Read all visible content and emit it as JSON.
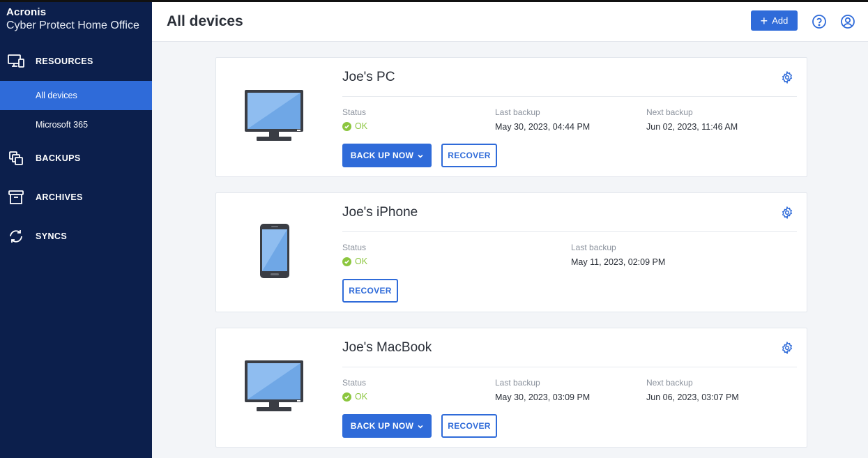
{
  "app": {
    "brand": "Acronis",
    "product": "Cyber Protect Home Office"
  },
  "sidebar": {
    "sections": [
      {
        "label": "RESOURCES",
        "icon": "devices-icon"
      },
      {
        "label": "BACKUPS",
        "icon": "backups-icon"
      },
      {
        "label": "ARCHIVES",
        "icon": "archive-box-icon"
      },
      {
        "label": "SYNCS",
        "icon": "sync-icon"
      }
    ],
    "resources_items": [
      {
        "label": "All devices",
        "active": true
      },
      {
        "label": "Microsoft 365",
        "active": false
      }
    ]
  },
  "header": {
    "title": "All devices",
    "add_label": "Add",
    "icons": [
      "help-icon",
      "account-icon"
    ]
  },
  "labels": {
    "status": "Status",
    "last_backup": "Last backup",
    "next_backup": "Next backup",
    "back_up_now": "BACK UP NOW",
    "recover": "RECOVER"
  },
  "devices": [
    {
      "name": "Joe's PC",
      "type": "desktop",
      "status": "OK",
      "last_backup": "May 30, 2023, 04:44 PM",
      "next_backup": "Jun 02, 2023, 11:46 AM"
    },
    {
      "name": "Joe's iPhone",
      "type": "phone",
      "status": "OK",
      "last_backup": "May 11, 2023, 02:09 PM"
    },
    {
      "name": "Joe's MacBook",
      "type": "desktop",
      "status": "OK",
      "last_backup": "May 30, 2023, 03:09 PM",
      "next_backup": "Jun 06, 2023, 03:07 PM"
    }
  ],
  "colors": {
    "sidebar_bg": "#0c1f4c",
    "accent": "#2f6bd9",
    "status_ok": "#8cc63f"
  }
}
